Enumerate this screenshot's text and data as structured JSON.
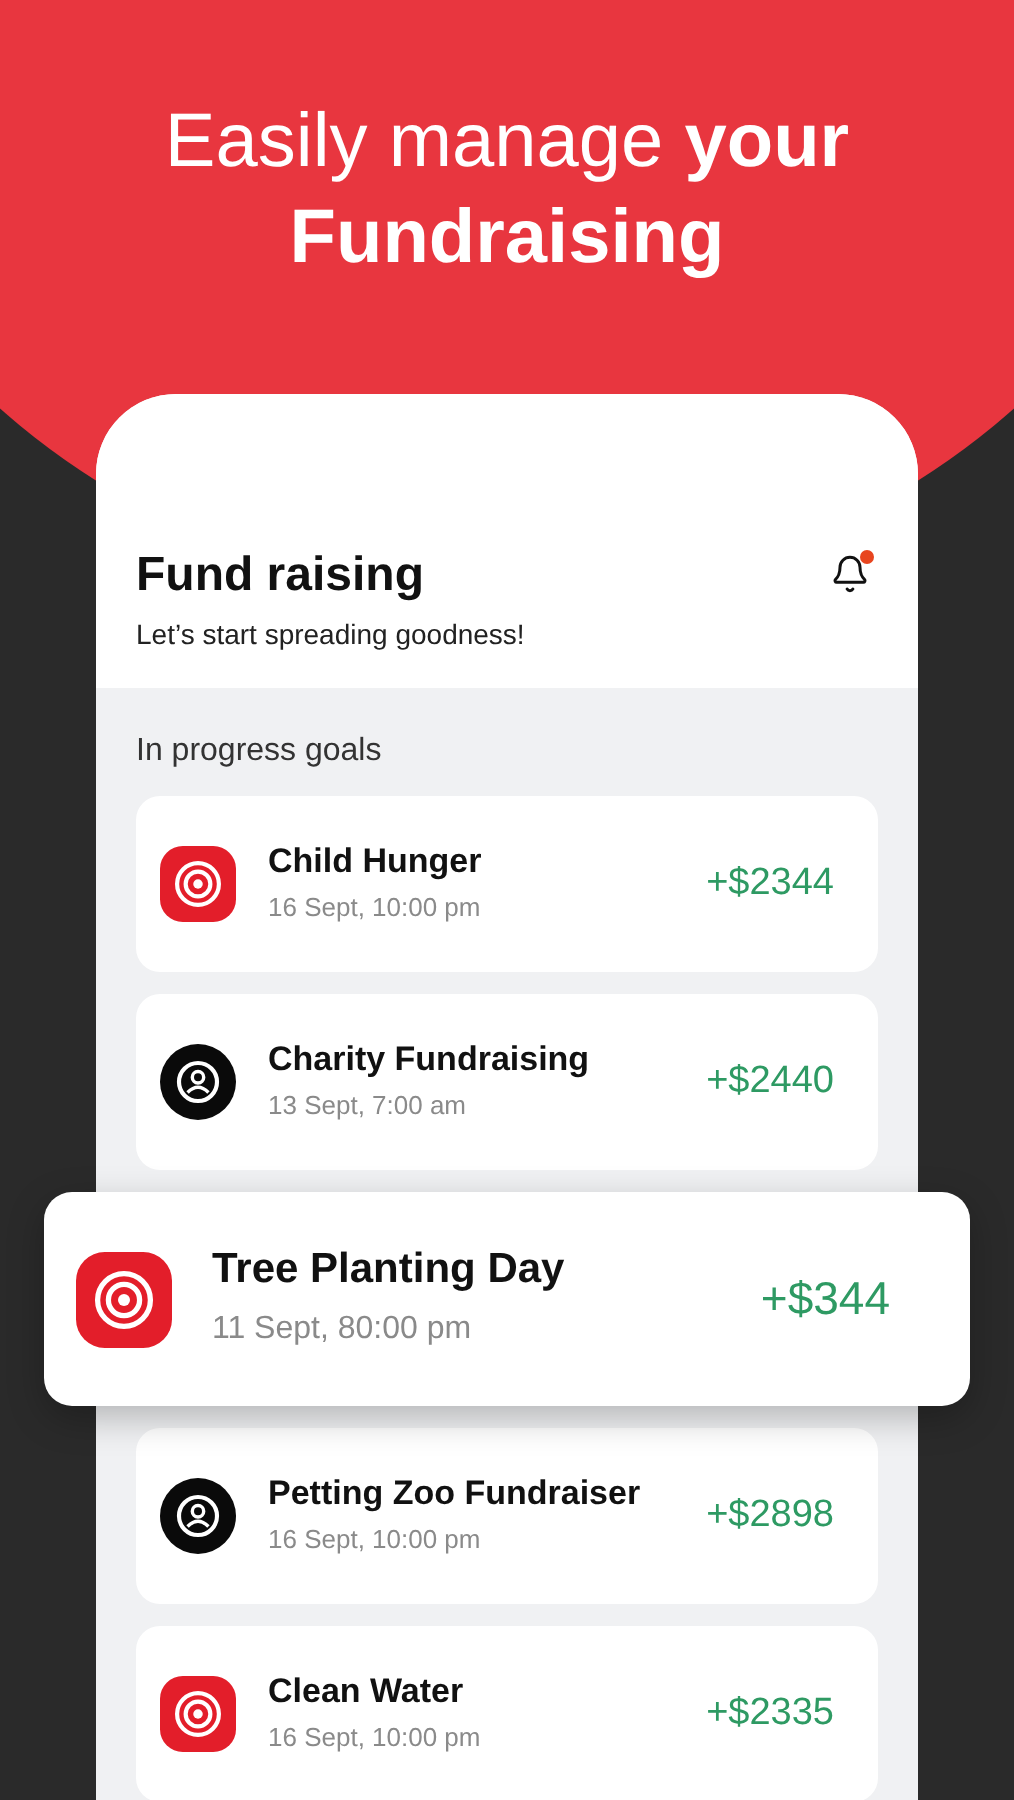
{
  "headline": "Easily manage **your Fundraising**",
  "header": {
    "title": "Fund raising",
    "subtitle": "Let’s start spreading goodness!",
    "notification": true
  },
  "section_title": "In progress goals",
  "goals": [
    {
      "kind": "target",
      "name": "Child Hunger",
      "date": "16 Sept, 10:00 pm",
      "amount": "+$2344",
      "selected": false
    },
    {
      "kind": "person",
      "name": "Charity Fundraising",
      "date": "13 Sept, 7:00 am",
      "amount": "+$2440",
      "selected": false
    },
    {
      "kind": "target",
      "name": "Tree Planting Day",
      "date": "11 Sept, 80:00 pm",
      "amount": "+$344",
      "selected": true
    },
    {
      "kind": "person",
      "name": "Petting Zoo Fundraiser",
      "date": "16 Sept, 10:00 pm",
      "amount": "+$2898",
      "selected": false
    },
    {
      "kind": "target",
      "name": "Clean Water",
      "date": "16 Sept, 10:00 pm",
      "amount": "+$2335",
      "selected": false
    }
  ]
}
